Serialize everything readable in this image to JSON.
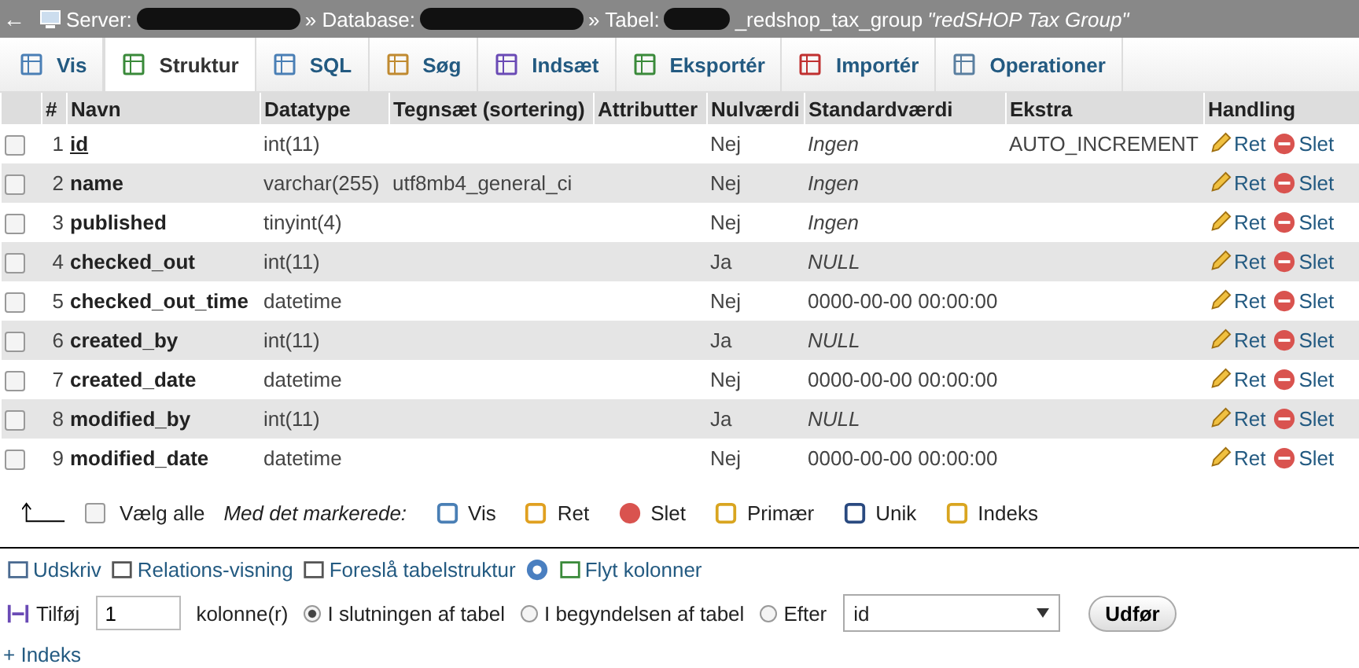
{
  "breadcrumb": {
    "back": "←",
    "server_label": "Server:",
    "database_label": "» Database:",
    "table_label": "» Tabel:",
    "table_name": "_redshop_tax_group",
    "comment": "\"redSHOP Tax Group\""
  },
  "tabs": [
    {
      "label": "Vis",
      "selected": false
    },
    {
      "label": "Struktur",
      "selected": true
    },
    {
      "label": "SQL",
      "selected": false
    },
    {
      "label": "Søg",
      "selected": false
    },
    {
      "label": "Indsæt",
      "selected": false
    },
    {
      "label": "Eksportér",
      "selected": false
    },
    {
      "label": "Importér",
      "selected": false
    },
    {
      "label": "Operationer",
      "selected": false
    }
  ],
  "table": {
    "columns": [
      "#",
      "Navn",
      "Datatype",
      "Tegnsæt (sortering)",
      "Attributter",
      "Nulværdi",
      "Standardværdi",
      "Ekstra",
      "Handling"
    ],
    "rows": [
      {
        "checked": false,
        "num": "1",
        "name": "id",
        "primary": true,
        "type": "int(11)",
        "collation": "",
        "attributes": "",
        "null": "Nej",
        "default": "Ingen",
        "default_italic": true,
        "extra": "AUTO_INCREMENT",
        "edit": "Ret",
        "delete": "Slet"
      },
      {
        "checked": false,
        "num": "2",
        "name": "name",
        "primary": false,
        "type": "varchar(255)",
        "collation": "utf8mb4_general_ci",
        "attributes": "",
        "null": "Nej",
        "default": "Ingen",
        "default_italic": true,
        "extra": "",
        "edit": "Ret",
        "delete": "Slet"
      },
      {
        "checked": false,
        "num": "3",
        "name": "published",
        "primary": false,
        "type": "tinyint(4)",
        "collation": "",
        "attributes": "",
        "null": "Nej",
        "default": "Ingen",
        "default_italic": true,
        "extra": "",
        "edit": "Ret",
        "delete": "Slet"
      },
      {
        "checked": false,
        "num": "4",
        "name": "checked_out",
        "primary": false,
        "type": "int(11)",
        "collation": "",
        "attributes": "",
        "null": "Ja",
        "default": "NULL",
        "default_italic": true,
        "extra": "",
        "edit": "Ret",
        "delete": "Slet"
      },
      {
        "checked": false,
        "num": "5",
        "name": "checked_out_time",
        "primary": false,
        "type": "datetime",
        "collation": "",
        "attributes": "",
        "null": "Nej",
        "default": "0000-00-00 00:00:00",
        "default_italic": false,
        "extra": "",
        "edit": "Ret",
        "delete": "Slet"
      },
      {
        "checked": false,
        "num": "6",
        "name": "created_by",
        "primary": false,
        "type": "int(11)",
        "collation": "",
        "attributes": "",
        "null": "Ja",
        "default": "NULL",
        "default_italic": true,
        "extra": "",
        "edit": "Ret",
        "delete": "Slet"
      },
      {
        "checked": false,
        "num": "7",
        "name": "created_date",
        "primary": false,
        "type": "datetime",
        "collation": "",
        "attributes": "",
        "null": "Nej",
        "default": "0000-00-00 00:00:00",
        "default_italic": false,
        "extra": "",
        "edit": "Ret",
        "delete": "Slet"
      },
      {
        "checked": false,
        "num": "8",
        "name": "modified_by",
        "primary": false,
        "type": "int(11)",
        "collation": "",
        "attributes": "",
        "null": "Ja",
        "default": "NULL",
        "default_italic": true,
        "extra": "",
        "edit": "Ret",
        "delete": "Slet"
      },
      {
        "checked": false,
        "num": "9",
        "name": "modified_date",
        "primary": false,
        "type": "datetime",
        "collation": "",
        "attributes": "",
        "null": "Nej",
        "default": "0000-00-00 00:00:00",
        "default_italic": false,
        "extra": "",
        "edit": "Ret",
        "delete": "Slet"
      }
    ]
  },
  "bulk": {
    "select_all": {
      "label": "Vælg alle",
      "checked": false
    },
    "with_selected": "Med det markerede:",
    "actions": [
      "Vis",
      "Ret",
      "Slet",
      "Primær",
      "Unik",
      "Indeks"
    ]
  },
  "links": [
    "Udskriv",
    "Relations-visning",
    "Foreslå tabelstruktur",
    "Flyt kolonner"
  ],
  "add": {
    "label": "Tilføj",
    "count": "1",
    "unit": "kolonne(r)",
    "positions": [
      {
        "label": "I slutningen af tabel",
        "selected": true
      },
      {
        "label": "I begyndelsen af tabel",
        "selected": false
      },
      {
        "label": "Efter",
        "selected": false
      }
    ],
    "after": "id",
    "button": "Udfør"
  },
  "index_link": "+ Indeks"
}
